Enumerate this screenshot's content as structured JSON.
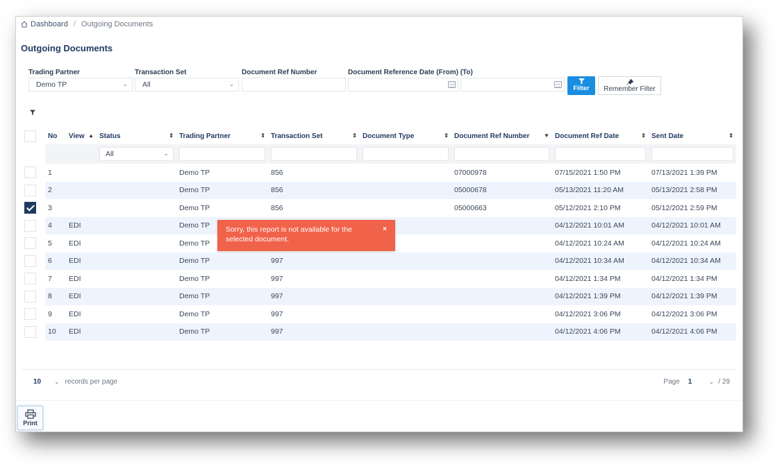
{
  "breadcrumb": {
    "home_icon": "home-icon",
    "home": "Dashboard",
    "separator": "/",
    "current": "Outgoing Documents"
  },
  "page_title": "Outgoing Documents",
  "filters": {
    "trading_partner": {
      "label": "Trading Partner",
      "value": "Demo TP"
    },
    "transaction_set": {
      "label": "Transaction Set",
      "value": "All"
    },
    "doc_ref_number": {
      "label": "Document Ref Number",
      "value": ""
    },
    "doc_ref_date": {
      "label": "Document Reference Date (From) (To)",
      "from": "",
      "to": ""
    },
    "filter_button": "Filter",
    "remember_button": "Remember Filter"
  },
  "table": {
    "columns": [
      "No",
      "View",
      "Status",
      "Trading Partner",
      "Transaction Set",
      "Document Type",
      "Document Ref Number",
      "Document Ref Date",
      "Sent Date"
    ],
    "status_filter": "All",
    "rows": [
      {
        "no": "1",
        "view": "",
        "status": "",
        "tp": "Demo TP",
        "set": "856",
        "type": "",
        "ref": "07000978",
        "ref_date": "07/15/2021 1:50 PM",
        "sent": "07/13/2021 1:39 PM",
        "checked": false
      },
      {
        "no": "2",
        "view": "",
        "status": "",
        "tp": "Demo TP",
        "set": "856",
        "type": "",
        "ref": "05000678",
        "ref_date": "05/13/2021 11:20 AM",
        "sent": "05/13/2021 2:58 PM",
        "checked": false
      },
      {
        "no": "3",
        "view": "",
        "status": "",
        "tp": "Demo TP",
        "set": "856",
        "type": "",
        "ref": "05000663",
        "ref_date": "05/12/2021 2:10 PM",
        "sent": "05/12/2021 2:59 PM",
        "checked": true
      },
      {
        "no": "4",
        "view": "EDI",
        "status": "",
        "tp": "Demo TP",
        "set": "",
        "type": "",
        "ref": "",
        "ref_date": "04/12/2021 10:01 AM",
        "sent": "04/12/2021 10:01 AM",
        "checked": false
      },
      {
        "no": "5",
        "view": "EDI",
        "status": "",
        "tp": "Demo TP",
        "set": "",
        "type": "",
        "ref": "",
        "ref_date": "04/12/2021 10:24 AM",
        "sent": "04/12/2021 10:24 AM",
        "checked": false
      },
      {
        "no": "6",
        "view": "EDI",
        "status": "",
        "tp": "Demo TP",
        "set": "997",
        "type": "",
        "ref": "",
        "ref_date": "04/12/2021 10:34 AM",
        "sent": "04/12/2021 10:34 AM",
        "checked": false
      },
      {
        "no": "7",
        "view": "EDI",
        "status": "",
        "tp": "Demo TP",
        "set": "997",
        "type": "",
        "ref": "",
        "ref_date": "04/12/2021 1:34 PM",
        "sent": "04/12/2021 1:34 PM",
        "checked": false
      },
      {
        "no": "8",
        "view": "EDI",
        "status": "",
        "tp": "Demo TP",
        "set": "997",
        "type": "",
        "ref": "",
        "ref_date": "04/12/2021 1:39 PM",
        "sent": "04/12/2021 1:39 PM",
        "checked": false
      },
      {
        "no": "9",
        "view": "EDI",
        "status": "",
        "tp": "Demo TP",
        "set": "997",
        "type": "",
        "ref": "",
        "ref_date": "04/12/2021 3:06 PM",
        "sent": "04/12/2021 3:06 PM",
        "checked": false
      },
      {
        "no": "10",
        "view": "EDI",
        "status": "",
        "tp": "Demo TP",
        "set": "997",
        "type": "",
        "ref": "",
        "ref_date": "04/12/2021 4:06 PM",
        "sent": "04/12/2021 4:06 PM",
        "checked": false
      }
    ]
  },
  "toast": {
    "message": "Sorry, this report is not available for the selected document.",
    "close": "×",
    "color": "#f1624a"
  },
  "pagination": {
    "per_page": "10",
    "per_page_label": "records per page",
    "page_label": "Page",
    "page": "1",
    "total": "/ 29"
  },
  "print_button": "Print",
  "colors": {
    "primary": "#1a8ee0",
    "heading": "#1f3a5f",
    "row_alt": "#eef4fd"
  }
}
